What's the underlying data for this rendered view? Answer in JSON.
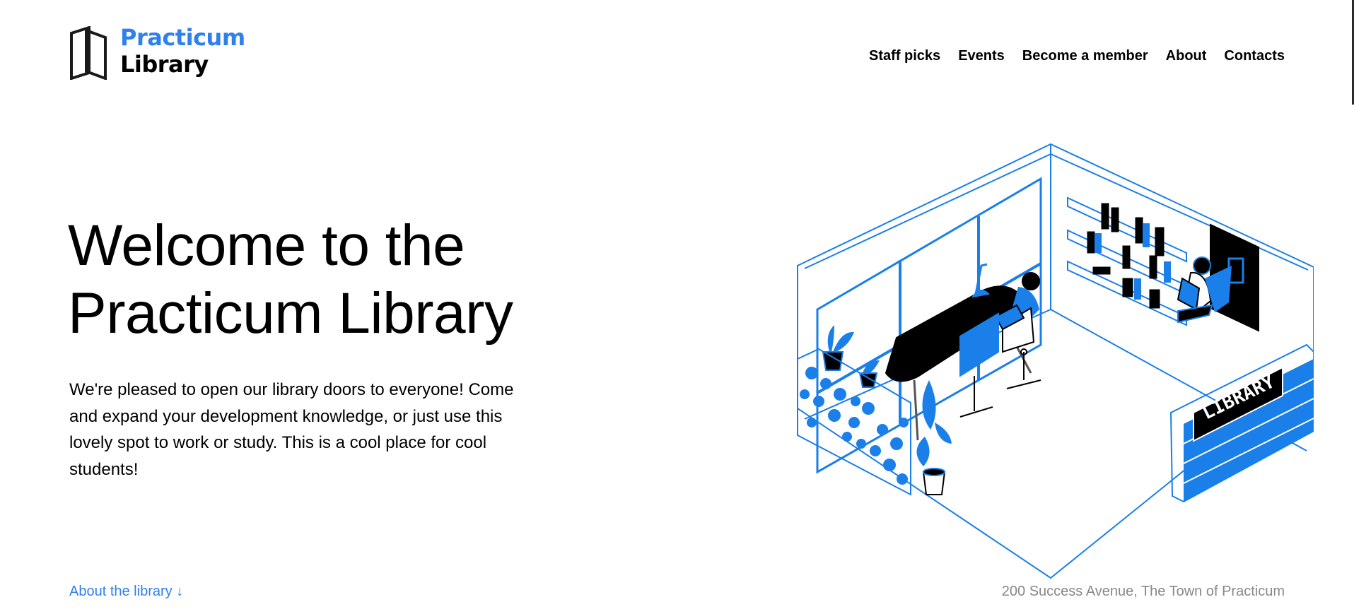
{
  "brand": {
    "name_line1": "Practicum",
    "name_line2": "Library",
    "accent_color": "#2f80ed"
  },
  "nav": {
    "items": [
      {
        "label": "Staff picks"
      },
      {
        "label": "Events"
      },
      {
        "label": "Become a member"
      },
      {
        "label": "About"
      },
      {
        "label": "Contacts"
      }
    ]
  },
  "hero": {
    "title": "Welcome to the Practicum Library",
    "intro": "We're pleased to open our library doors to everyone! Come and expand your development knowledge, or just use this lovely spot to work or study. This is a cool place for cool students!",
    "illustration_sign": "LIBRARY"
  },
  "footer": {
    "about_link": "About the library ↓",
    "address": "200 Success Avenue, The Town of Practicum"
  }
}
